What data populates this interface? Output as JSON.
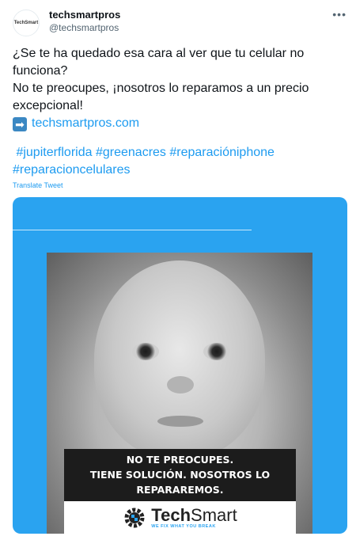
{
  "tweet": {
    "author": {
      "display_name": "techsmartpros",
      "handle": "@techsmartpros",
      "avatar_text": "TechSmart"
    },
    "more_icon": "more-horizontal-icon",
    "body_line1": "¿Se te ha quedado esa cara al ver que tu celular no funciona?",
    "body_line2": "No te preocupes, ¡nosotros lo reparamos a un precio excepcional!",
    "arrow_emoji": "➡",
    "link": "techsmartpros.com",
    "hashtags": [
      "#jupiterflorida",
      "#greenacres",
      "#reparacióniphone",
      "#reparacioncelulares"
    ],
    "translate_label": "Translate Tweet"
  },
  "media": {
    "background_color": "#2aa3f0",
    "banner_lines": [
      "NO TE PREOCUPES.",
      "TIENE SOLUCIÓN. NOSOTROS LO",
      "REPARAREMOS."
    ],
    "brand": {
      "name_bold": "Tech",
      "name_light": "Smart",
      "tagline": "WE FIX WHAT YOU BREAK"
    }
  },
  "colors": {
    "link": "#1d9bf0",
    "text": "#0f1419",
    "muted": "#536471"
  }
}
